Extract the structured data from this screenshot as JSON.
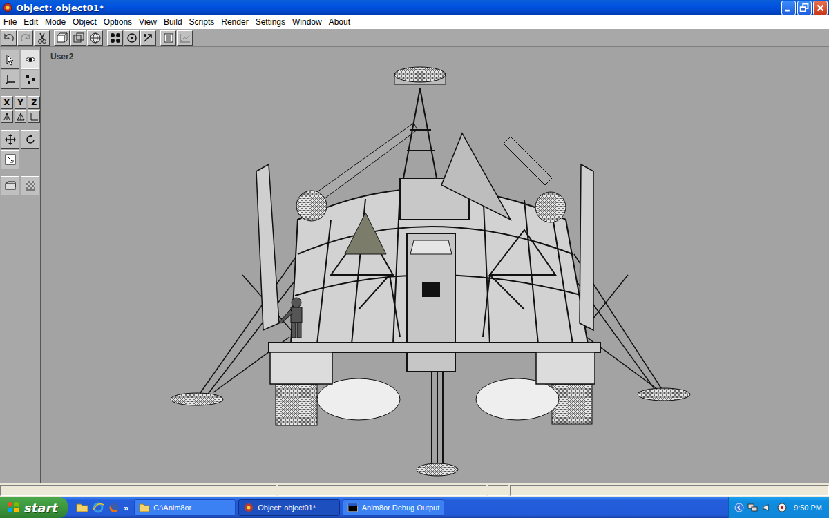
{
  "window": {
    "title": "Object: object01*"
  },
  "menu": [
    "File",
    "Edit",
    "Mode",
    "Object",
    "Options",
    "View",
    "Build",
    "Scripts",
    "Render",
    "Settings",
    "Window",
    "About"
  ],
  "palette": {
    "tools": [
      {
        "selected": false
      },
      {
        "selected": true
      },
      {
        "selected": false
      },
      {
        "selected": false
      },
      {
        "selected": false
      },
      {
        "selected": false
      },
      {
        "selected": false
      },
      {
        "selected": false
      },
      {
        "selected": false
      },
      {
        "selected": false
      },
      {
        "selected": false
      },
      {
        "selected": false
      }
    ],
    "axes": [
      {
        "label": "X",
        "selected": false
      },
      {
        "label": "Y",
        "selected": false
      },
      {
        "label": "Z",
        "selected": false
      }
    ]
  },
  "viewport": {
    "label": "User2"
  },
  "taskbar": {
    "start": "start",
    "quick_launch_more": "»",
    "tasks": [
      {
        "label": "C:\\Anim8or",
        "selected": false
      },
      {
        "label": "Object: object01*",
        "selected": true
      },
      {
        "label": "Anim8or Debug Output",
        "selected": false
      }
    ],
    "clock": "9:50 PM"
  }
}
